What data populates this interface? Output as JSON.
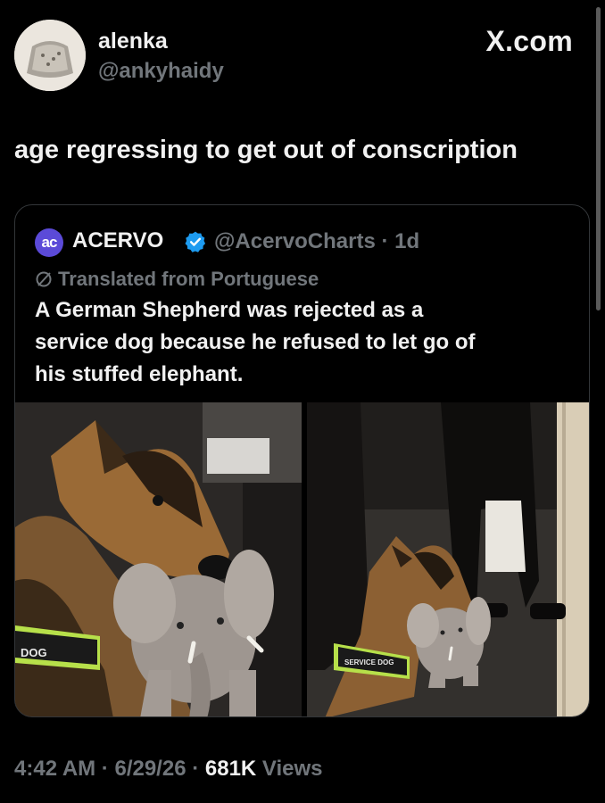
{
  "author": {
    "display_name": "alenka",
    "handle": "@ankyhaidy"
  },
  "brand": "X.com",
  "tweet_text": "age regressing to get out of conscription",
  "quoted": {
    "logo_text": "ac",
    "name": "ACERVO",
    "handle_time": "@AcervoCharts · 1d",
    "translated": "Translated from Portuguese",
    "lines": [
      "A German Shepherd was rejected as a",
      "service dog because he refused to let go of",
      "his stuffed elephant."
    ],
    "photos": {
      "left_vest_text": "DOG",
      "right_vest_text": "SERVICE DOG"
    }
  },
  "meta": {
    "time": "4:42 AM",
    "sep1": " · ",
    "date": "6/29/26",
    "sep2": " · ",
    "views_count": "681K",
    "views_label": " Views"
  },
  "colors": {
    "background": "#000000",
    "secondary_text": "#71767b",
    "verified_badge": "#1d9bf0",
    "acervo_logo": "#5b4ad8"
  }
}
